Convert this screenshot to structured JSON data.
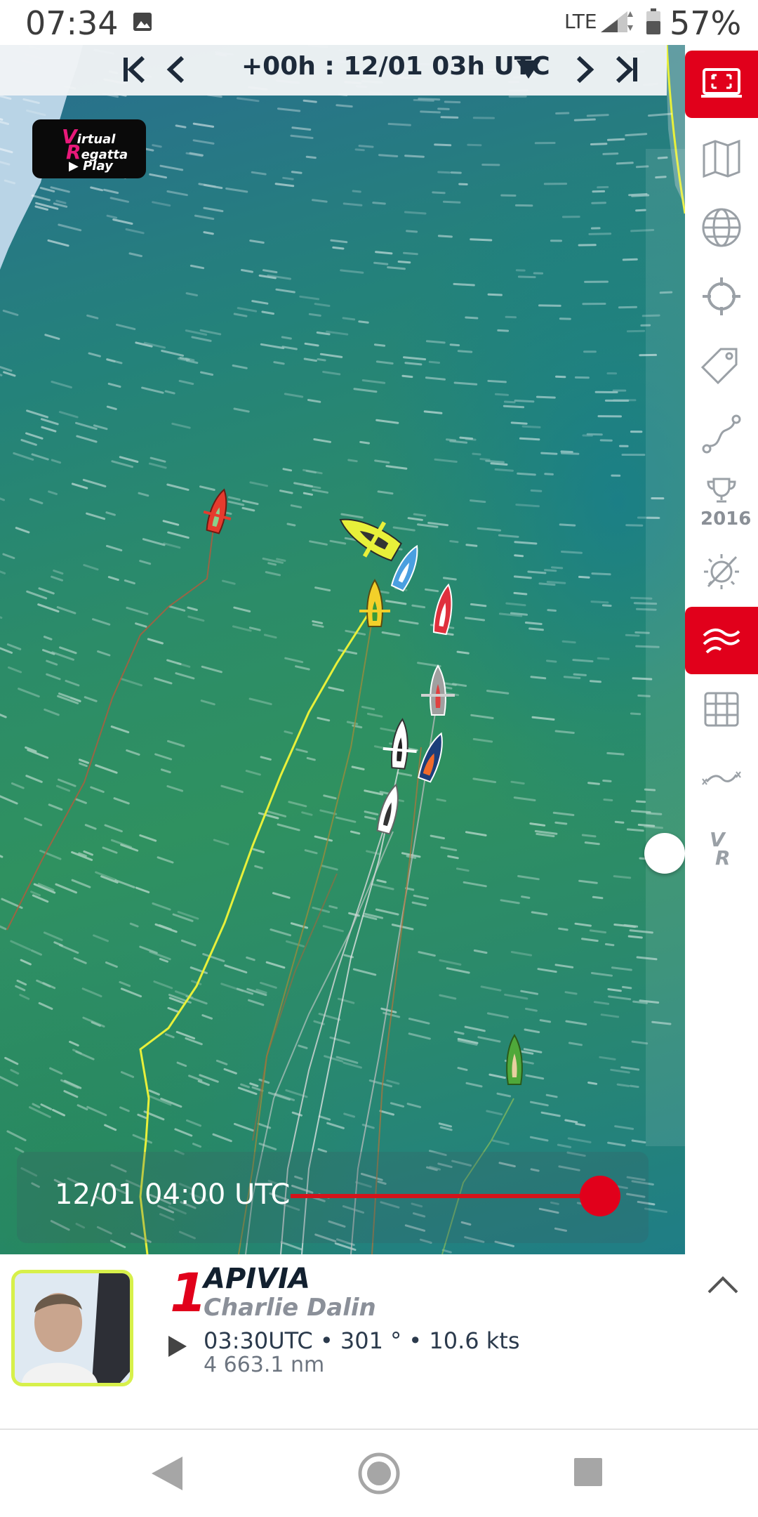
{
  "status_bar": {
    "time": "07:34",
    "network": "LTE",
    "battery": "57%",
    "icons": [
      "image-notification-icon",
      "signal-icon",
      "battery-icon"
    ]
  },
  "time_nav": {
    "label": "+00h : 12/01 03h UTC",
    "buttons": [
      "skip-first-icon",
      "previous-icon",
      "next-icon",
      "skip-last-icon"
    ],
    "dropdown_icon": "caret-down-icon"
  },
  "logo": {
    "line1_initial": "V",
    "line1_rest": "irtual",
    "line2_initial": "R",
    "line2_rest": "egatta",
    "play": "▶ Play"
  },
  "toolbar": {
    "items": [
      {
        "icon": "fullscreen-icon",
        "active": true
      },
      {
        "icon": "map-icon",
        "active": false
      },
      {
        "icon": "globe-icon",
        "active": false
      },
      {
        "icon": "crosshair-icon",
        "active": false
      },
      {
        "icon": "tag-icon",
        "active": false
      },
      {
        "icon": "route-icon",
        "active": false
      },
      {
        "icon": "trophy-icon",
        "active": false,
        "label": "2016"
      },
      {
        "icon": "wind-off-icon",
        "active": false
      },
      {
        "icon": "wind-icon",
        "active": true
      },
      {
        "icon": "grid-icon",
        "active": false
      },
      {
        "icon": "track-icon",
        "active": false
      },
      {
        "icon": "vr-icon",
        "active": false
      }
    ]
  },
  "timeline": {
    "date_label": "12/01 04:00 UTC",
    "position": 1.0
  },
  "boat": {
    "rank": "1",
    "name": "APIVIA",
    "skipper": "Charlie Dalin",
    "stats": "03:30UTC • 301 ° • 10.6 kts",
    "distance": "4 663.1 nm"
  },
  "colors": {
    "accent": "#e1001b",
    "ocean": "#2b8a6a",
    "player_track": "#e8f03a"
  }
}
